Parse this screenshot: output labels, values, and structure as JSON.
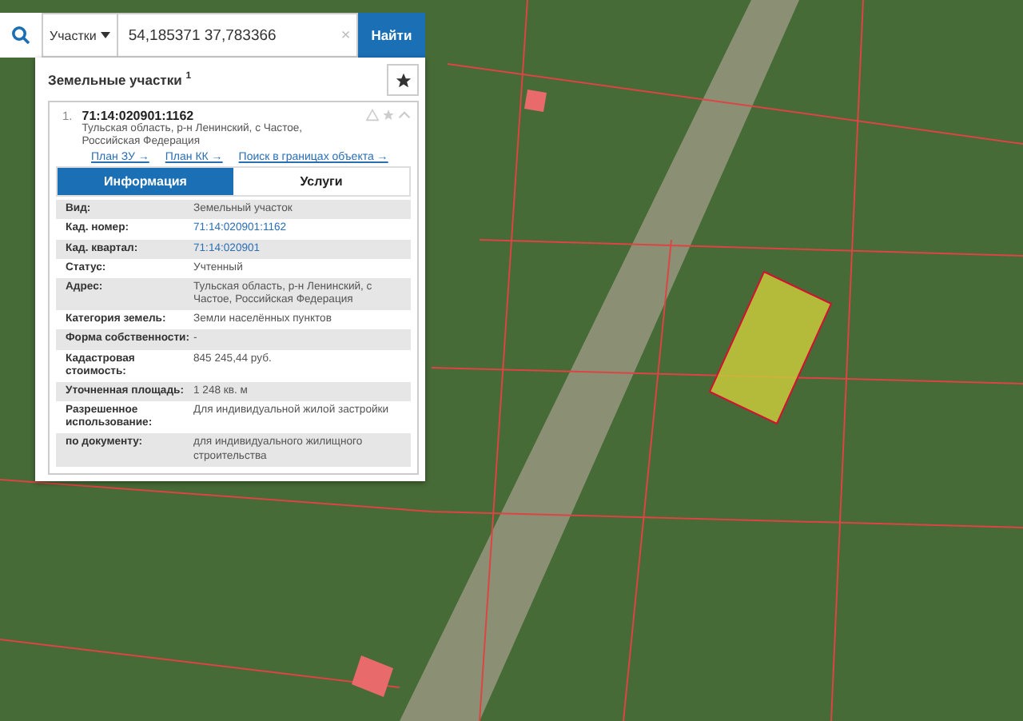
{
  "search": {
    "scope": "Участки",
    "value": "54,185371 37,783366",
    "clear": "×",
    "button": "Найти"
  },
  "panel": {
    "title": "Земельные участки",
    "count": "1"
  },
  "result": {
    "index": "1.",
    "number": "71:14:020901:1162",
    "address": "Тульская область, р-н Ленинский, с Частое, Российская Федерация",
    "links": [
      "План ЗУ →",
      "План КК →",
      "Поиск в границах объекта →"
    ]
  },
  "tabs": [
    {
      "label": "Информация",
      "selected": true
    },
    {
      "label": "Услуги",
      "selected": false
    }
  ],
  "rows": [
    {
      "label": "Вид:",
      "value": "Земельный участок",
      "kind": "text"
    },
    {
      "label": "Кад. номер:",
      "value": "71:14:020901:1162",
      "kind": "link"
    },
    {
      "label": "Кад. квартал:",
      "value": "71:14:020901",
      "kind": "link"
    },
    {
      "label": "Статус:",
      "value": "Учтенный",
      "kind": "text"
    },
    {
      "label": "Адрес:",
      "value": "Тульская область, р-н Ленинский, с Частое, Российская Федерация",
      "kind": "text"
    },
    {
      "label": "Категория земель:",
      "value": "Земли населённых пунктов",
      "kind": "text"
    },
    {
      "label": "Форма собственности:",
      "value": "-",
      "kind": "text"
    },
    {
      "label": "Кадастровая стоимость:",
      "value": "845 245,44 руб.",
      "kind": "text"
    },
    {
      "label": "Уточненная площадь:",
      "value": "1 248 кв. м",
      "kind": "text"
    },
    {
      "label": "Разрешенное использование:",
      "value": "Для индивидуальной жилой застройки",
      "kind": "text"
    },
    {
      "label": "по документу:",
      "value": "для индивидуального жилищного строительства",
      "kind": "text"
    }
  ]
}
